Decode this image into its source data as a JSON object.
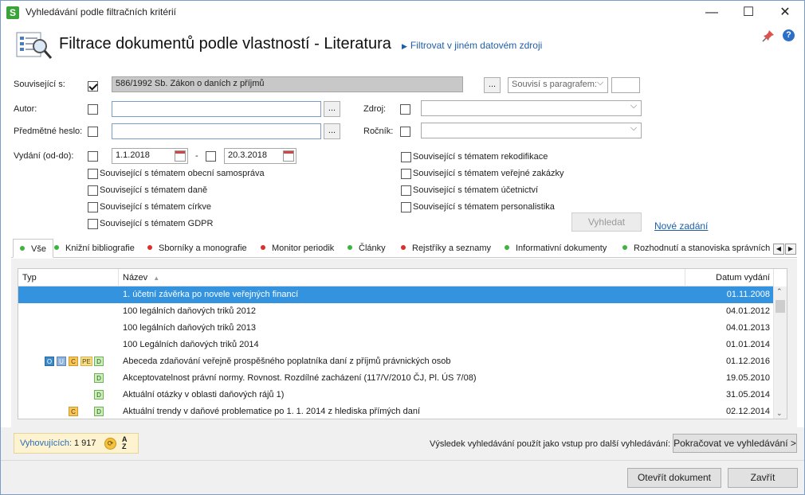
{
  "window": {
    "title": "Vyhledávání podle filtračních kritérií",
    "icon_letter": "S",
    "minimize": "—",
    "maximize": "☐",
    "close": "✕"
  },
  "header": {
    "title": "Filtrace dokumentů podle vlastností - Literatura",
    "link": "Filtrovat v jiném datovém zdroji",
    "help": "?"
  },
  "form": {
    "souvisejici_label": "Související s:",
    "souvisejici_value": "586/1992 Sb. Zákon o daních z příjmů",
    "souvisejici_checked": true,
    "dots": "...",
    "paragraf_placeholder": "Souvisí s paragrafem:",
    "autor_label": "Autor:",
    "autor_value": "",
    "heslo_label": "Předmětné heslo:",
    "heslo_value": "",
    "vydani_label": "Vydání (od-do):",
    "date_from": "1.1.2018",
    "date_sep": "-",
    "date_to": "20.3.2018",
    "zdroj_label": "Zdroj:",
    "zdroj_value": "",
    "rocnik_label": "Ročník:",
    "rocnik_value": "",
    "topics_left": [
      "Související s tématem obecní samospráva",
      "Související s tématem daně",
      "Související s tématem církve",
      "Související s tématem GDPR"
    ],
    "topics_right": [
      "Související s tématem rekodifikace",
      "Související s tématem veřejné zakázky",
      "Související s tématem účetnictví",
      "Související s tématem personalistika"
    ],
    "search_button": "Vyhledat",
    "new_search_link": "Nové zadání"
  },
  "tabs": [
    {
      "label": "Vše",
      "color": "#3fb33f"
    },
    {
      "label": "Knižní bibliografie",
      "color": "#3fb33f"
    },
    {
      "label": "Sborníky a monografie",
      "color": "#d93030"
    },
    {
      "label": "Monitor periodik",
      "color": "#d93030"
    },
    {
      "label": "Články",
      "color": "#3fb33f"
    },
    {
      "label": "Rejstříky a seznamy",
      "color": "#d93030"
    },
    {
      "label": "Informativní dokumenty",
      "color": "#3fb33f"
    },
    {
      "label": "Rozhodnutí a stanoviska správních",
      "color": "#3fb33f"
    }
  ],
  "grid": {
    "col_typ": "Typ",
    "col_nazev": "Název",
    "col_datum": "Datum vydání",
    "sort_indicator": "▲",
    "rows": [
      {
        "tags": [],
        "name": "1. účetní závěrka po novele veřejných financí",
        "date": "01.11.2008"
      },
      {
        "tags": [],
        "name": "100 legálních daňových triků 2012",
        "date": "04.01.2012"
      },
      {
        "tags": [],
        "name": "100 legálních daňových triků 2013",
        "date": "04.01.2013"
      },
      {
        "tags": [],
        "name": "100 Legálních daňových triků 2014",
        "date": "01.01.2014"
      },
      {
        "tags": [
          "O",
          "U",
          "C",
          "PE",
          "D"
        ],
        "name": "Abeceda zdaňování veřejně prospěšného poplatníka daní z příjmů právnických osob",
        "date": "01.12.2016"
      },
      {
        "tags": [
          "D"
        ],
        "name": "Akceptovatelnost právní normy. Rovnost. Rozdílné zacházení (117/V/2010 ČJ, Pl. ÚS 7/08)",
        "date": "19.05.2010"
      },
      {
        "tags": [
          "D"
        ],
        "name": "Aktuální otázky v oblasti daňových rájů 1)",
        "date": "31.05.2014"
      },
      {
        "tags": [
          "C",
          "D"
        ],
        "name": "Aktuální trendy v daňové problematice po 1. 1. 2014 z hlediska přímých daní",
        "date": "02.12.2014"
      }
    ]
  },
  "footer": {
    "count_label": "Vyhovujících:",
    "count_value": "1 917",
    "reuse_text": "Výsledek vyhledávání použít jako vstup pro další vyhledávání:",
    "continue_button": "Pokračovat ve vyhledávání >",
    "open_button": "Otevřít dokument",
    "close_button": "Zavřít"
  }
}
